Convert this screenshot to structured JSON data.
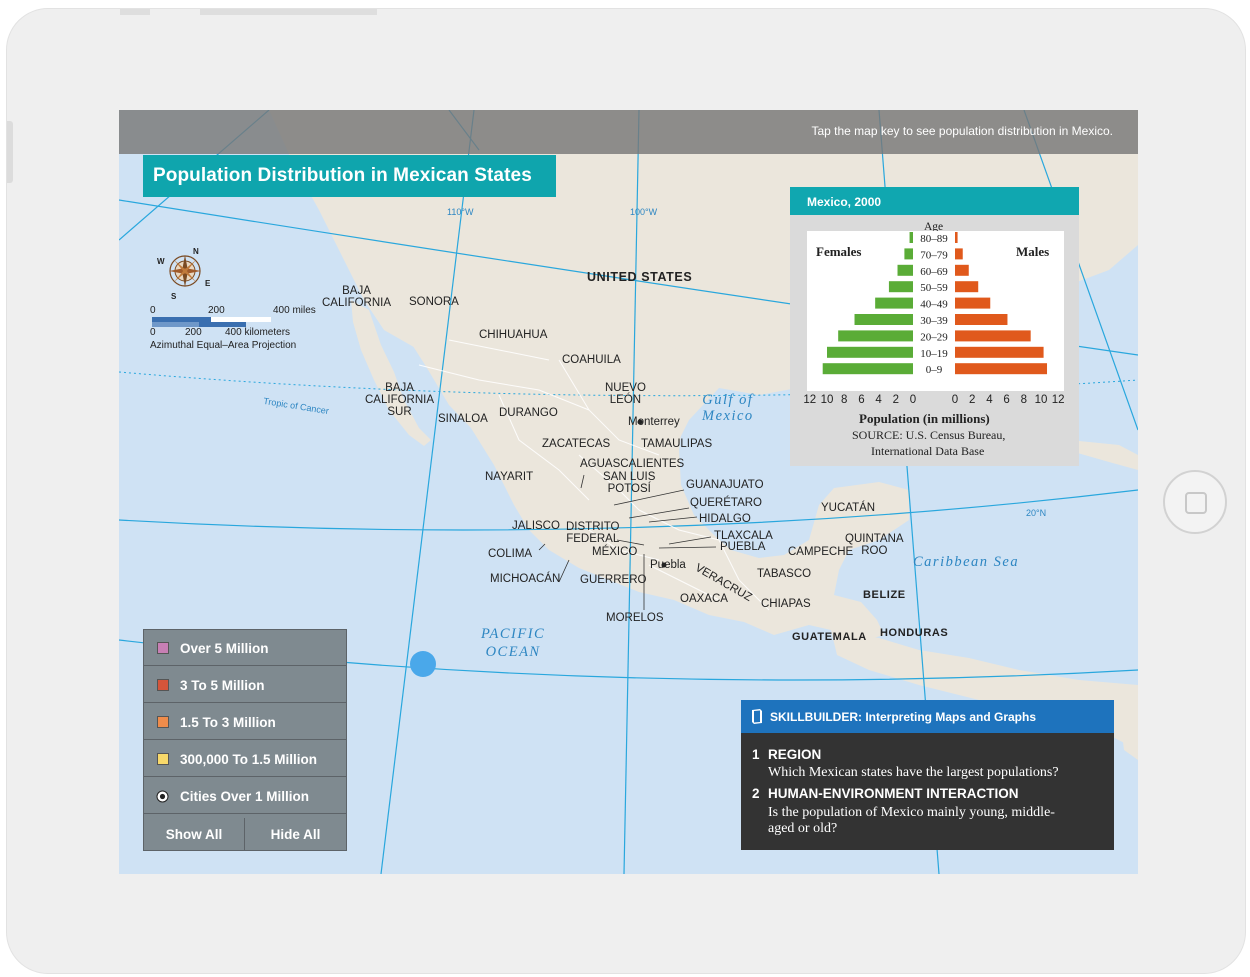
{
  "colors": {
    "accent": "#10a7b0",
    "skill": "#1e73bd",
    "female": "#5aac37",
    "male": "#e0591c",
    "water": "#d7e7f5",
    "land": "#ebe6dc"
  },
  "topbar": {
    "hint": "Tap the map key to see population distribution in Mexico."
  },
  "map": {
    "title": "Population Distribution in Mexican States",
    "scale": {
      "miles_0": "0",
      "miles_200": "200",
      "miles_400": "400 miles",
      "km_0": "0",
      "km_200": "200",
      "km_400": "400 kilometers",
      "projection": "Azimuthal Equal–Area Projection"
    },
    "compass": {
      "icon": "compass-rose-icon",
      "n": "N",
      "e": "E",
      "s": "S",
      "w": "W"
    },
    "latlong": {
      "w110": "110°W",
      "w100": "100°W",
      "n20": "20°N",
      "tropic": "Tropic of Cancer"
    },
    "countries": {
      "us": "UNITED STATES",
      "belize": "BELIZE",
      "guatemala": "GUATEMALA",
      "honduras": "HONDURAS"
    },
    "water": {
      "gulf_1": "Gulf of",
      "gulf_2": "Mexico",
      "pacific_1": "PACIFIC",
      "pacific_2": "OCEAN",
      "caribbean": "Caribbean Sea"
    },
    "states": {
      "baja_california_1": "BAJA",
      "baja_california_2": "CALIFORNIA",
      "sonora": "SONORA",
      "chihuahua": "CHIHUAHUA",
      "coahuila": "COAHUILA",
      "nuevo_leon_1": "NUEVO",
      "nuevo_leon_2": "LEÓN",
      "bcs_1": "BAJA",
      "bcs_2": "CALIFORNIA",
      "bcs_3": "SUR",
      "sinaloa": "SINALOA",
      "durango": "DURANGO",
      "zacatecas": "ZACATECAS",
      "tamaulipas": "TAMAULIPAS",
      "aguascalientes": "AGUASCALIENTES",
      "slp_1": "SAN LUIS",
      "slp_2": "POTOSÍ",
      "nayarit": "NAYARIT",
      "guanajuato": "GUANAJUATO",
      "queretaro": "QUERÉTARO",
      "hidalgo": "HIDALGO",
      "jalisco": "JALISCO",
      "df_1": "DISTRITO",
      "df_2": "FEDERAL",
      "tlaxcala": "TLAXCALA",
      "mexico": "MÉXICO",
      "puebla": "PUEBLA",
      "colima": "COLIMA",
      "michoacan": "MICHOACÁN",
      "guerrero": "GUERRERO",
      "veracruz": "VERACRUZ",
      "oaxaca": "OAXACA",
      "morelos": "MORELOS",
      "tabasco": "TABASCO",
      "campeche": "CAMPECHE",
      "chiapas": "CHIAPAS",
      "yucatan": "YUCATÁN",
      "quintana_roo_1": "QUINTANA",
      "quintana_roo_2": "ROO"
    },
    "cities": {
      "monterrey": "Monterrey",
      "puebla": "Puebla"
    }
  },
  "pyramid": {
    "title": "Mexico, 2000",
    "age_label": "Age",
    "females_label": "Females",
    "males_label": "Males",
    "xlabel": "Population (in millions)",
    "source_1": "SOURCE: U.S. Census Bureau,",
    "source_2": "International Data Base",
    "female_ticks": [
      "12",
      "10",
      "8",
      "6",
      "4",
      "2",
      "0"
    ],
    "male_ticks": [
      "0",
      "2",
      "4",
      "6",
      "8",
      "10",
      "12"
    ]
  },
  "chart_data": {
    "type": "bar",
    "title": "Mexico, 2000",
    "categories": [
      "80–89",
      "70–79",
      "60–69",
      "50–59",
      "40–49",
      "30–39",
      "20–29",
      "10–19",
      "0–9"
    ],
    "series": [
      {
        "name": "Females",
        "values": [
          0.4,
          1.0,
          1.8,
          2.8,
          4.4,
          6.8,
          8.7,
          10.0,
          10.5
        ]
      },
      {
        "name": "Males",
        "values": [
          0.3,
          0.9,
          1.6,
          2.7,
          4.1,
          6.1,
          8.8,
          10.3,
          10.7
        ]
      }
    ],
    "xlabel": "Population (in millions)",
    "ylabel": "Age",
    "xlim": [
      0,
      12
    ]
  },
  "legend": {
    "items": [
      {
        "label": "Over 5 Million",
        "color": "#c77fb4"
      },
      {
        "label": "3 To 5 Million",
        "color": "#d4553a"
      },
      {
        "label": "1.5 To 3 Million",
        "color": "#ef8c4b"
      },
      {
        "label": "300,000 To 1.5 Million",
        "color": "#f8d96a"
      },
      {
        "label": "Cities Over 1 Million",
        "color": ""
      }
    ],
    "show_all": "Show All",
    "hide_all": "Hide All"
  },
  "skillbuilder": {
    "icon": "book-icon",
    "title": "SKILLBUILDER: Interpreting Maps and Graphs",
    "q1_num": "1",
    "q1_head": "REGION",
    "q1_body": "Which Mexican states have the largest populations?",
    "q2_num": "2",
    "q2_head": "HUMAN-ENVIRONMENT INTERACTION",
    "q2_body_1": "Is the population of Mexico mainly young, middle-",
    "q2_body_2": "aged or old?"
  }
}
